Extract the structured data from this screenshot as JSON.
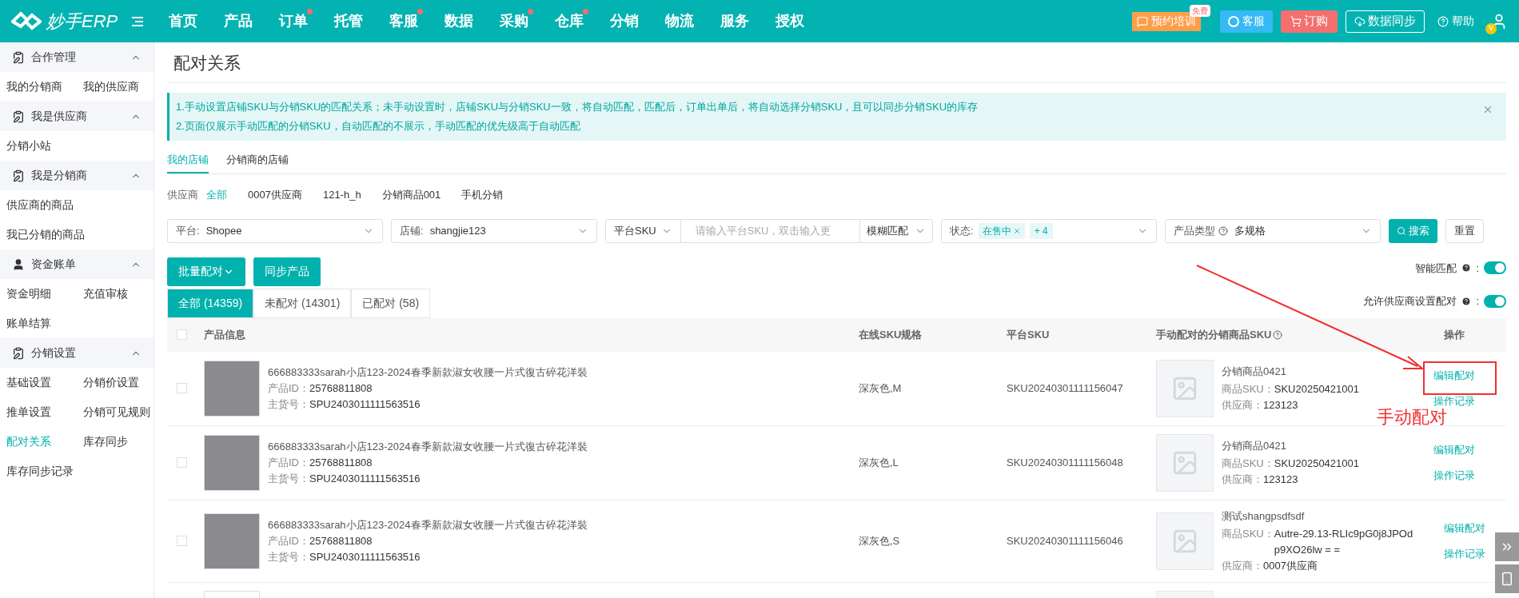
{
  "header": {
    "logo": "妙手ERP",
    "nav": [
      {
        "label": "首页",
        "dot": false
      },
      {
        "label": "产品",
        "dot": false
      },
      {
        "label": "订单",
        "dot": true
      },
      {
        "label": "托管",
        "dot": false
      },
      {
        "label": "客服",
        "dot": true
      },
      {
        "label": "数据",
        "dot": false
      },
      {
        "label": "采购",
        "dot": true
      },
      {
        "label": "仓库",
        "dot": true
      },
      {
        "label": "分销",
        "dot": false
      },
      {
        "label": "物流",
        "dot": false
      },
      {
        "label": "服务",
        "dot": false
      },
      {
        "label": "授权",
        "dot": false
      }
    ],
    "training": {
      "label": "预约培训",
      "badge": "免费"
    },
    "service": "客服",
    "order": "订购",
    "sync": "数据同步",
    "help": "帮助",
    "avatar_badge": "V"
  },
  "sidebar": [
    {
      "title": "合作管理",
      "kind": "clipboard",
      "expanded": true,
      "items": [
        {
          "label": "我的分销商",
          "selected": false
        },
        {
          "label": "我的供应商",
          "selected": false
        }
      ]
    },
    {
      "title": "我是供应商",
      "kind": "clipboard",
      "expanded": true,
      "items": [
        {
          "label": "分销小站",
          "selected": false
        }
      ]
    },
    {
      "title": "我是分销商",
      "kind": "clipboard",
      "expanded": true,
      "items": [
        {
          "label": "供应商的商品",
          "selected": false
        },
        {
          "label": "我已分销的商品",
          "selected": false
        }
      ]
    },
    {
      "title": "资金账单",
      "kind": "user",
      "expanded": true,
      "items": [
        {
          "label": "资金明细",
          "selected": false
        },
        {
          "label": "充值审核",
          "selected": false
        },
        {
          "label": "账单结算",
          "selected": false
        }
      ]
    },
    {
      "title": "分销设置",
      "kind": "clipboard",
      "expanded": true,
      "items": [
        {
          "label": "基础设置",
          "selected": false
        },
        {
          "label": "分销价设置",
          "selected": false
        },
        {
          "label": "推单设置",
          "selected": false
        },
        {
          "label": "分销可见规则",
          "selected": false
        },
        {
          "label": "配对关系",
          "selected": true
        },
        {
          "label": "库存同步",
          "selected": false
        },
        {
          "label": "库存同步记录",
          "selected": false
        }
      ]
    }
  ],
  "page_title": "配对关系",
  "notice": [
    "1.手动设置店铺SKU与分销SKU的匹配关系；未手动设置时，店铺SKU与分销SKU一致，将自动匹配，匹配后，订单出单后，将自动选择分销SKU，且可以同步分销SKU的库存",
    "2.页面仅展示手动匹配的分销SKU，自动匹配的不展示，手动匹配的优先级高于自动匹配"
  ],
  "store_tabs": [
    {
      "label": "我的店铺",
      "selected": true
    },
    {
      "label": "分销商的店铺",
      "selected": false
    }
  ],
  "supplier_filter": {
    "label": "供应商",
    "options": [
      {
        "label": "全部",
        "selected": true
      },
      {
        "label": "0007供应商",
        "selected": false
      },
      {
        "label": "121-h_h",
        "selected": false
      },
      {
        "label": "分销商品001",
        "selected": false
      },
      {
        "label": "手机分销",
        "selected": false
      }
    ]
  },
  "filters": {
    "platform": {
      "label": "平台:",
      "value": "Shopee"
    },
    "store": {
      "label": "店铺:",
      "value": "shangjie123"
    },
    "sku": {
      "field": "平台SKU",
      "placeholder": "请输入平台SKU，双击输入更",
      "match": "模糊匹配"
    },
    "status": {
      "label": "状态:",
      "tag": "在售中",
      "more": "+ 4"
    },
    "type": {
      "label": "产品类型",
      "value": "多规格"
    },
    "search": "搜索",
    "reset": "重置"
  },
  "actions": {
    "batch": "批量配对",
    "sync": "同步产品"
  },
  "toggles": [
    {
      "label": "智能匹配",
      "colon": ":",
      "on": true
    },
    {
      "label": "允许供应商设置配对",
      "colon": ":",
      "on": true
    }
  ],
  "tabs": [
    {
      "label": "全部 (14359)",
      "selected": true
    },
    {
      "label": "未配对 (14301)",
      "selected": false
    },
    {
      "label": "已配对 (58)",
      "selected": false
    }
  ],
  "table": {
    "select_all": {
      "checked": false
    },
    "columns": [
      "产品信息",
      "在线SKU规格",
      "平台SKU",
      "手动配对的分销商品SKU",
      "操作"
    ],
    "rows": [
      {
        "checked": false,
        "title": "666883333sarah小店123-2024春季新款淑女收腰一片式復古碎花洋裝",
        "id_label": "产品ID：",
        "id": "25768811808",
        "spu_label": "主货号：",
        "spu": "SPU2403011111563516",
        "spec": "深灰色,M",
        "platform_sku": "SKU20240301111156047",
        "match_name": "分销商品0421",
        "sku_label": "商品SKU：",
        "sku_lines": [
          "SKU20250421001"
        ],
        "supplier_label": "供应商：",
        "supplier": "123123",
        "edit": "编辑配对",
        "log": "操作记录"
      },
      {
        "checked": false,
        "title": "666883333sarah小店123-2024春季新款淑女收腰一片式復古碎花洋裝",
        "id_label": "产品ID：",
        "id": "25768811808",
        "spu_label": "主货号：",
        "spu": "SPU2403011111563516",
        "spec": "深灰色,L",
        "platform_sku": "SKU20240301111156048",
        "match_name": "分销商品0421",
        "sku_label": "商品SKU：",
        "sku_lines": [
          "SKU20250421001"
        ],
        "supplier_label": "供应商：",
        "supplier": "123123",
        "edit": "编辑配对",
        "log": "操作记录"
      },
      {
        "checked": false,
        "title": "666883333sarah小店123-2024春季新款淑女收腰一片式復古碎花洋裝",
        "id_label": "产品ID：",
        "id": "25768811808",
        "spu_label": "主货号：",
        "spu": "SPU2403011111563516",
        "spec": "深灰色,S",
        "platform_sku": "SKU20240301111156046",
        "match_name": "测试shangpsdfsdf",
        "sku_label": "商品SKU：",
        "sku_lines": [
          "Autre-29.13-RLIc9pG0j8JPOd",
          "p9XO26lw = ="
        ],
        "supplier_label": "供应商：",
        "supplier": "0007供应商",
        "edit": "编辑配对",
        "log": "操作记录"
      }
    ]
  },
  "annotation": {
    "text": "手动配对"
  }
}
